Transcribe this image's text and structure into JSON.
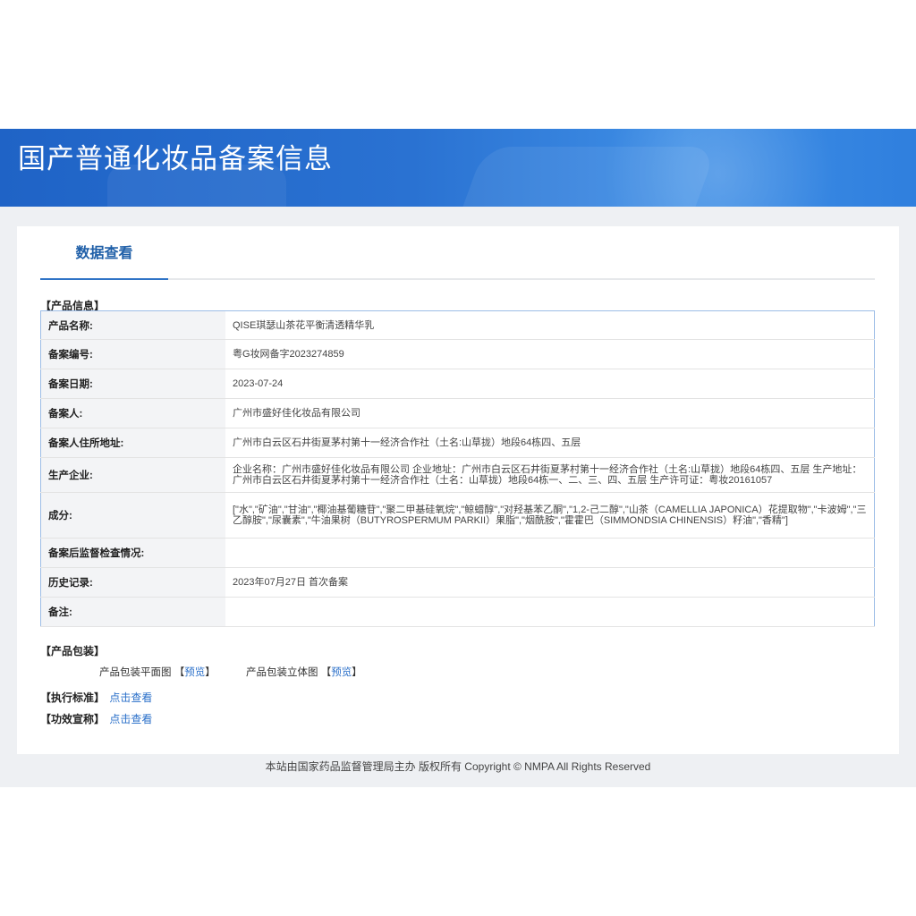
{
  "header": {
    "title": "国产普通化妆品备案信息"
  },
  "tabs": [
    {
      "label": "数据查看"
    }
  ],
  "product_info": {
    "section_label": "【产品信息】",
    "rows": [
      {
        "label": "产品名称:",
        "value": "QISE琪瑟山茶花平衡清透精华乳"
      },
      {
        "label": "备案编号:",
        "value": "粤G妆网备字2023274859"
      },
      {
        "label": "备案日期:",
        "value": "2023-07-24"
      },
      {
        "label": "备案人:",
        "value": "广州市盛好佳化妆品有限公司"
      },
      {
        "label": "备案人住所地址:",
        "value": "广州市白云区石井街夏茅村第十一经济合作社（土名:山草拢）地段64栋四、五层"
      },
      {
        "label": "生产企业:",
        "value": "企业名称：广州市盛好佳化妆品有限公司 企业地址：广州市白云区石井街夏茅村第十一经济合作社（土名:山草拢）地段64栋四、五层 生产地址：广州市白云区石井街夏茅村第十一经济合作社（土名：山草拢）地段64栋一、二、三、四、五层 生产许可证：粤妆20161057"
      },
      {
        "label": "成分:",
        "value": "[\"水\",\"矿油\",\"甘油\",\"椰油基葡糖苷\",\"聚二甲基硅氧烷\",\"鲸蜡醇\",\"对羟基苯乙酮\",\"1,2-己二醇\",\"山茶（CAMELLIA JAPONICA）花提取物\",\"卡波姆\",\"三乙醇胺\",\"尿囊素\",\"牛油果树（BUTYROSPERMUM PARKII）果脂\",\"烟酰胺\",\"霍霍巴（SIMMONDSIA CHINENSIS）籽油\",\"香精\"]"
      },
      {
        "label": "备案后监督检查情况:",
        "value": ""
      },
      {
        "label": "历史记录:",
        "value": "2023年07月27日 首次备案"
      },
      {
        "label": "备注:",
        "value": ""
      }
    ]
  },
  "packaging": {
    "section_label": "【产品包装】",
    "flat_label": "产品包装平面图",
    "solid_label": "产品包装立体图",
    "preview_link": "预览",
    "bracket_open": "【",
    "bracket_close": "】"
  },
  "standard": {
    "section_label": "【执行标准】",
    "link": "点击查看"
  },
  "efficacy": {
    "section_label": "【功效宣称】",
    "link": "点击查看"
  },
  "footer": {
    "text": "本站由国家药品监督管理局主办 版权所有 Copyright © NMPA All Rights Reserved"
  },
  "colors": {
    "banner": "#2a72d2",
    "link": "#2a6fc9",
    "tab_accent": "#2f73c6"
  }
}
